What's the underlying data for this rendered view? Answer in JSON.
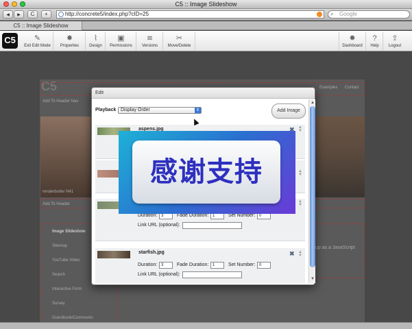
{
  "window": {
    "title": "C5 :: Image Slideshow"
  },
  "browser": {
    "url": "http://concrete5/index.php?cID=25",
    "search_placeholder": "Google",
    "tab_title": "C5 :: Image Slideshow",
    "back_glyph": "◀",
    "forward_glyph": "▶",
    "reload_glyph": "C",
    "add_glyph": "+"
  },
  "c5bar": {
    "logo": "C5",
    "left_items": [
      {
        "label": "Exit Edit Mode",
        "icon": "pencil-icon"
      },
      {
        "label": "Properties",
        "icon": "gear-icon"
      },
      {
        "label": "Design",
        "icon": "brush-icon"
      },
      {
        "label": "Permissions",
        "icon": "lock-icon"
      },
      {
        "label": "Versions",
        "icon": "versions-icon"
      },
      {
        "label": "Move/Delete",
        "icon": "scissors-icon"
      }
    ],
    "right_items": [
      {
        "label": "Dashboard",
        "icon": "dashboard-icon"
      },
      {
        "label": "Help",
        "icon": "help-icon"
      },
      {
        "label": "Logout",
        "icon": "logout-icon"
      }
    ]
  },
  "page": {
    "site_name": "C5",
    "nav_examples": "Examples",
    "nav_contact": "Contact",
    "add_to_header_nav": "Add To Header Nav",
    "add_to_header": "Add To Header",
    "photo_caption": "renderbutler N41",
    "sidebar_items": [
      "Image Slideshow",
      "Sitemap",
      "YouTube Video",
      "Search",
      "Interactive Form",
      "Survey",
      "Guestbook/Comments"
    ],
    "right_text": "up  as a JavaScript"
  },
  "dialog": {
    "title": "Edit",
    "playback_label": "Playback",
    "playback_value": "Display Order",
    "add_image_label": "Add Image",
    "duration_label": "Duration:",
    "fade_label": "Fade Duration:",
    "set_label": "Set Number:",
    "link_label": "Link URL (optional):",
    "rows": [
      {
        "name": "aspens.jpg",
        "duration": "",
        "fade": "",
        "set": "",
        "thumb_color": "#8c9a6a"
      },
      {
        "name": "",
        "duration": "",
        "fade": "",
        "set": "",
        "thumb_color": "#b07a6a"
      },
      {
        "name": "",
        "duration": "3",
        "fade": "1",
        "set": "0",
        "thumb_color": "#7a8a6a"
      },
      {
        "name": "starfish.jpg",
        "duration": "3",
        "fade": "1",
        "set": "0",
        "thumb_color": "#6a5a4a"
      }
    ]
  },
  "overlay": {
    "text": "感谢支持"
  },
  "colors": {
    "dialog_bg": "#ffffff",
    "scroll_thumb": "#5f8fd6",
    "overlay_grad_start": "#1eb1d6",
    "overlay_grad_end": "#6a3ad8",
    "overlay_text": "#2d2fbf"
  }
}
